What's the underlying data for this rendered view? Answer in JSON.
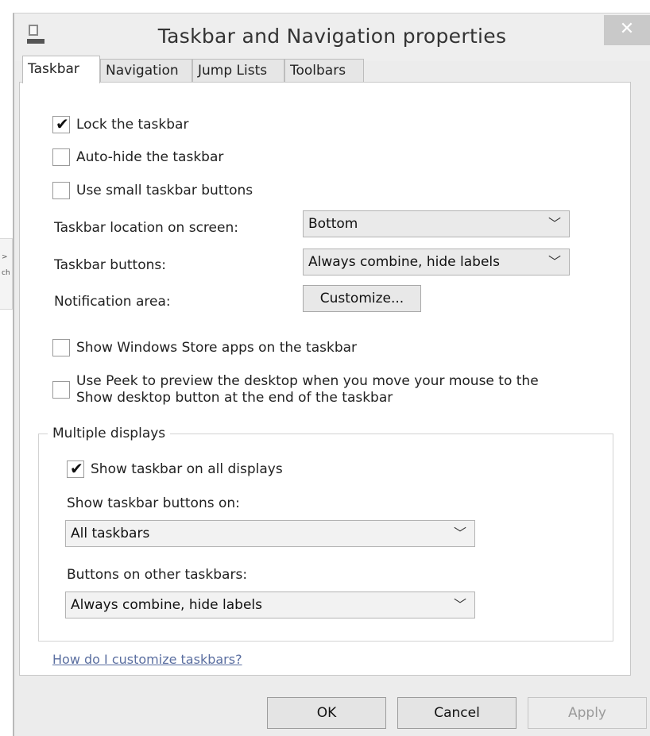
{
  "background": {
    "edge_labels": [
      ">",
      "ch"
    ]
  },
  "window": {
    "title": "Taskbar and Navigation properties",
    "close_label": "✕"
  },
  "tabs": [
    {
      "label": "Taskbar",
      "active": true
    },
    {
      "label": "Navigation",
      "active": false
    },
    {
      "label": "Jump Lists",
      "active": false
    },
    {
      "label": "Toolbars",
      "active": false
    }
  ],
  "options": {
    "lock_taskbar": {
      "label": "Lock the taskbar",
      "checked": true
    },
    "auto_hide": {
      "label": "Auto-hide the taskbar",
      "checked": false
    },
    "small_buttons": {
      "label": "Use small taskbar buttons",
      "checked": false
    }
  },
  "location": {
    "label": "Taskbar location on screen:",
    "value": "Bottom"
  },
  "buttons": {
    "label": "Taskbar buttons:",
    "value": "Always combine, hide labels"
  },
  "notification": {
    "label": "Notification area:",
    "button": "Customize..."
  },
  "store_apps": {
    "label": "Show Windows Store apps on the taskbar",
    "checked": false
  },
  "peek": {
    "line1": "Use Peek to preview the desktop when you move your mouse to the",
    "line2": "Show desktop button at the end of the taskbar",
    "checked": false
  },
  "multiple_displays": {
    "title": "Multiple displays",
    "show_all": {
      "label": "Show taskbar on all displays",
      "checked": true
    },
    "buttons_on_label": "Show taskbar buttons on:",
    "buttons_on_value": "All taskbars",
    "other_label": "Buttons on other taskbars:",
    "other_value": "Always combine, hide labels"
  },
  "help_link": "How do I customize taskbars?",
  "footer": {
    "ok": "OK",
    "cancel": "Cancel",
    "apply": "Apply"
  },
  "colors": {
    "link": "#5a6ea0",
    "close_button": "#c9c9c9"
  }
}
